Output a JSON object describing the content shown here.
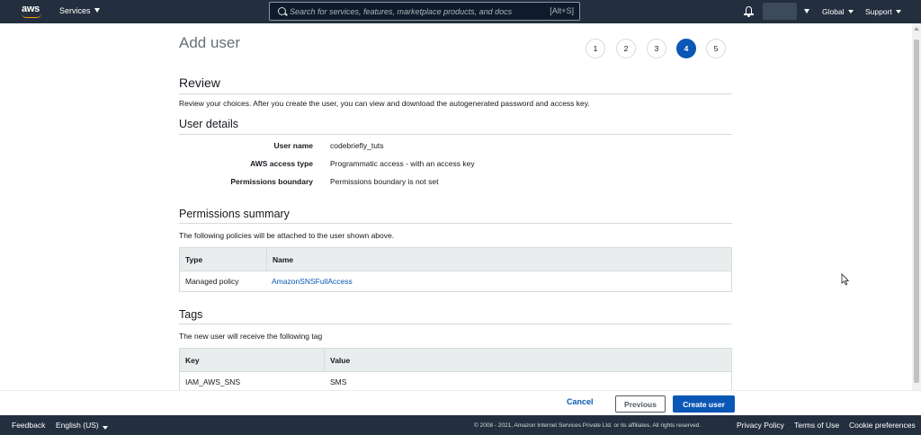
{
  "topnav": {
    "logo": "aws",
    "services_label": "Services",
    "search_placeholder": "Search for services, features, marketplace products, and docs",
    "search_shortcut": "[Alt+S]",
    "region_label": "Global",
    "support_label": "Support",
    "colors": {
      "background": "#232f3e",
      "accent": "#ff9900"
    }
  },
  "page": {
    "title": "Add user",
    "steps": [
      "1",
      "2",
      "3",
      "4",
      "5"
    ],
    "active_step": "4"
  },
  "review": {
    "title": "Review",
    "description": "Review your choices. After you create the user, you can view and download the autogenerated password and access key."
  },
  "user_details": {
    "title": "User details",
    "rows": [
      {
        "label": "User name",
        "value": "codebriefly_tuts"
      },
      {
        "label": "AWS access type",
        "value": "Programmatic access - with an access key"
      },
      {
        "label": "Permissions boundary",
        "value": "Permissions boundary is not set"
      }
    ]
  },
  "permissions": {
    "title": "Permissions summary",
    "description": "The following policies will be attached to the user shown above.",
    "columns": [
      "Type",
      "Name"
    ],
    "rows": [
      {
        "type": "Managed policy",
        "name": "AmazonSNSFullAccess"
      }
    ]
  },
  "tags": {
    "title": "Tags",
    "description": "The new user will receive the following tag",
    "columns": [
      "Key",
      "Value"
    ],
    "rows": [
      {
        "key": "IAM_AWS_SNS",
        "value": "SMS"
      }
    ]
  },
  "actions": {
    "cancel": "Cancel",
    "previous": "Previous",
    "create": "Create user",
    "primary_color": "#0a57b6"
  },
  "footer": {
    "feedback": "Feedback",
    "language": "English (US)",
    "copyright": "© 2008 - 2021, Amazon Internet Services Private Ltd. or its affiliates. All rights reserved.",
    "privacy": "Privacy Policy",
    "terms": "Terms of Use",
    "cookies": "Cookie preferences"
  }
}
